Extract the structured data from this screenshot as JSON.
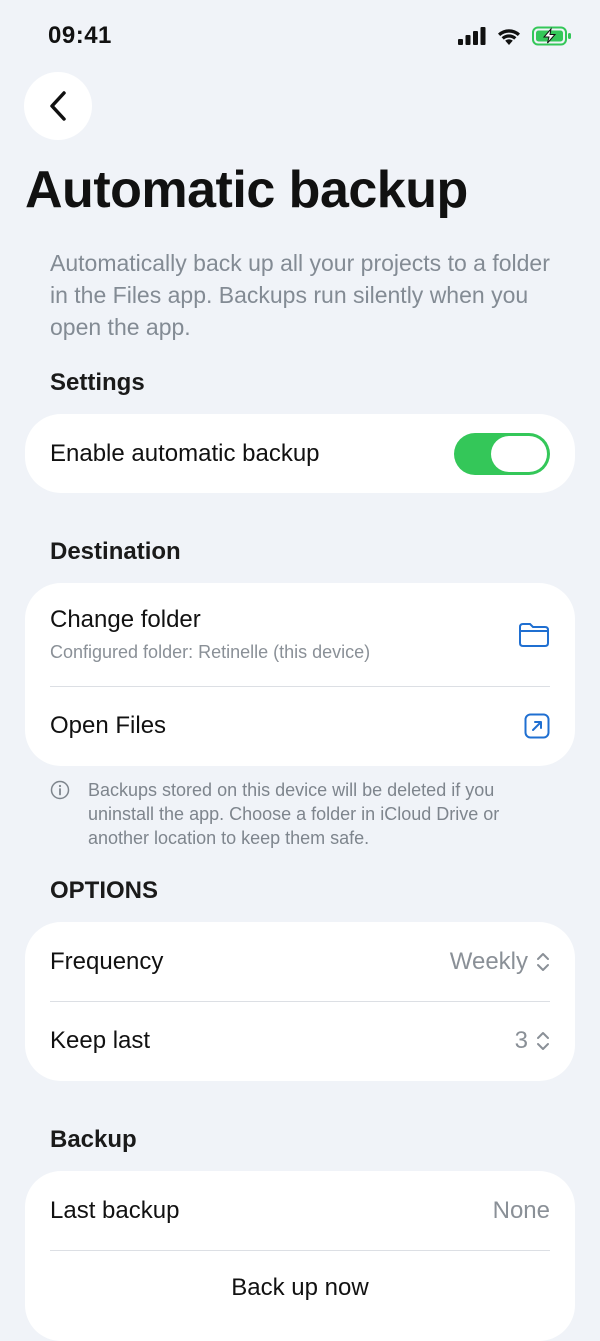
{
  "status": {
    "time": "09:41"
  },
  "icons": {
    "back": "chevron-left-icon",
    "folder": "folder-icon",
    "open": "arrow-up-right-square-icon",
    "info": "info-circle-icon",
    "updown": "chevron-up-down-icon"
  },
  "colors": {
    "accent": "#1f6fd1",
    "toggle_on": "#34c759",
    "background": "#f0f3f8"
  },
  "page": {
    "title": "Automatic backup",
    "intro": "Automatically back up all your projects to a folder in the Files app. Backups run silently when you open the app."
  },
  "settings": {
    "header": "Settings",
    "enable_label": "Enable automatic backup",
    "enabled": true
  },
  "destination": {
    "header": "Destination",
    "change_folder_label": "Change folder",
    "configured_folder": "Configured folder: Retinelle (this device)",
    "open_files_label": "Open Files",
    "note": "Backups stored on this device will be deleted if you uninstall the app. Choose a folder in iCloud Drive or another location to keep them safe."
  },
  "options": {
    "header": "OPTIONS",
    "frequency_label": "Frequency",
    "frequency_value": "Weekly",
    "keep_last_label": "Keep last",
    "keep_last_value": "3"
  },
  "backup": {
    "header": "Backup",
    "last_backup_label": "Last backup",
    "last_backup_value": "None",
    "back_up_now_label": "Back up now"
  }
}
